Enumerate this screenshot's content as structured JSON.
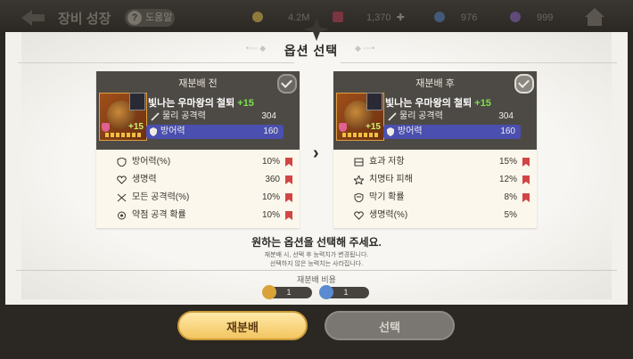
{
  "topbar": {
    "title": "장비 성장",
    "help_label": "도움말",
    "currencies": [
      {
        "icon": "gold-coin-icon",
        "value": "4.2M",
        "color": "#c9a233"
      },
      {
        "icon": "ruby-icon",
        "value": "1,370",
        "color": "#b03040"
      },
      {
        "icon": "blue-gem-icon",
        "value": "976",
        "color": "#4a78c8"
      },
      {
        "icon": "purple-gem-icon",
        "value": "999",
        "color": "#8a62c0"
      }
    ]
  },
  "header": {
    "title": "옵션 선택"
  },
  "before": {
    "label": "재분배 전",
    "selected": false,
    "item_name": "빛나는 우마왕의 철퇴",
    "item_level": "+15",
    "stats": [
      {
        "icon": "sword-icon",
        "name": "물리 공격력",
        "value": "304"
      },
      {
        "icon": "shield-icon",
        "name": "방어력",
        "value": "160",
        "highlight": true
      }
    ],
    "options": [
      {
        "icon": "armor-icon",
        "name": "방어력(%)",
        "value": "10%",
        "marked": true
      },
      {
        "icon": "heart-icon",
        "name": "생명력",
        "value": "360",
        "marked": true
      },
      {
        "icon": "crossed-swords-icon",
        "name": "모든 공격력(%)",
        "value": "10%",
        "marked": true
      },
      {
        "icon": "target-icon",
        "name": "약점 공격 확률",
        "value": "10%",
        "marked": true
      }
    ]
  },
  "after": {
    "label": "재분배 후",
    "selected": true,
    "item_name": "빛나는 우마왕의 철퇴",
    "item_level": "+15",
    "stats": [
      {
        "icon": "sword-icon",
        "name": "물리 공격력",
        "value": "304"
      },
      {
        "icon": "shield-icon",
        "name": "방어력",
        "value": "160",
        "highlight": true
      }
    ],
    "options": [
      {
        "icon": "resist-icon",
        "name": "효과 저항",
        "value": "15%",
        "marked": true
      },
      {
        "icon": "critical-icon",
        "name": "치명타 피해",
        "value": "12%",
        "marked": true
      },
      {
        "icon": "block-icon",
        "name": "막기 확률",
        "value": "8%",
        "marked": true
      },
      {
        "icon": "heart-icon",
        "name": "생명력(%)",
        "value": "5%",
        "marked": false
      }
    ]
  },
  "prompt": {
    "main": "원하는 옵션을 선택해 주세요.",
    "line1": "재분배 시, 선택 후 능력치가 변경됩니다.",
    "line2": "선택하지 않은 능력치는 사라집니다."
  },
  "cost": {
    "label": "재분배 비용",
    "items": [
      {
        "icon": "gold-coin-icon",
        "value": "1",
        "color": "#d9a23a"
      },
      {
        "icon": "blue-stone-icon",
        "value": "1",
        "color": "#5a8ad0"
      }
    ]
  },
  "buttons": {
    "redistribute": "재분배",
    "select": "선택"
  }
}
